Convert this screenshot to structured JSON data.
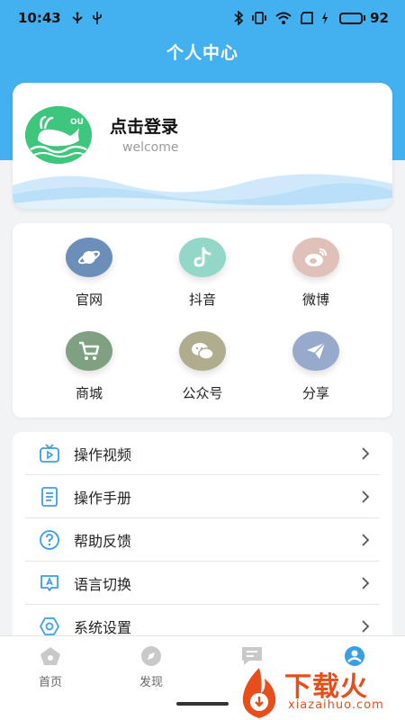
{
  "status_bar": {
    "time": "10:43",
    "battery_percent": "92",
    "battery_level": 0.92,
    "icons": [
      "usb-icon",
      "usb-debug-icon",
      "bluetooth-icon",
      "vibrate-icon",
      "wifi-icon",
      "sim-icon",
      "charging-icon",
      "battery-icon"
    ]
  },
  "header": {
    "title": "个人中心",
    "bg_color": "#43b1f0"
  },
  "profile": {
    "login_label": "点击登录",
    "welcome": "welcome",
    "avatar_color": "#3ec77c",
    "avatar_icon": "whale-logo",
    "avatar_letters": "OU"
  },
  "shortcuts": [
    {
      "label": "官网",
      "icon": "planet-icon",
      "color": "#6b8fb8"
    },
    {
      "label": "抖音",
      "icon": "tiktok-icon",
      "color": "#93d7c8"
    },
    {
      "label": "微博",
      "icon": "weibo-icon",
      "color": "#e0c1b9"
    },
    {
      "label": "商城",
      "icon": "cart-icon",
      "color": "#7fa081"
    },
    {
      "label": "公众号",
      "icon": "wechat-icon",
      "color": "#b0ad8e"
    },
    {
      "label": "分享",
      "icon": "send-icon",
      "color": "#97aacb"
    }
  ],
  "menu": [
    {
      "label": "操作视频",
      "icon": "tv-icon"
    },
    {
      "label": "操作手册",
      "icon": "document-icon"
    },
    {
      "label": "帮助反馈",
      "icon": "help-icon"
    },
    {
      "label": "语言切换",
      "icon": "language-icon"
    },
    {
      "label": "系统设置",
      "icon": "settings-icon"
    }
  ],
  "tabs": [
    {
      "label": "首页",
      "icon": "home-icon",
      "active": false
    },
    {
      "label": "发现",
      "icon": "discover-icon",
      "active": false
    },
    {
      "label": "",
      "icon": "message-icon",
      "active": false
    },
    {
      "label": "",
      "icon": "profile-icon",
      "active": true
    }
  ],
  "watermark": {
    "text": "下载火",
    "sub": "xiazaihuo.com",
    "color": "#e84e1b"
  }
}
